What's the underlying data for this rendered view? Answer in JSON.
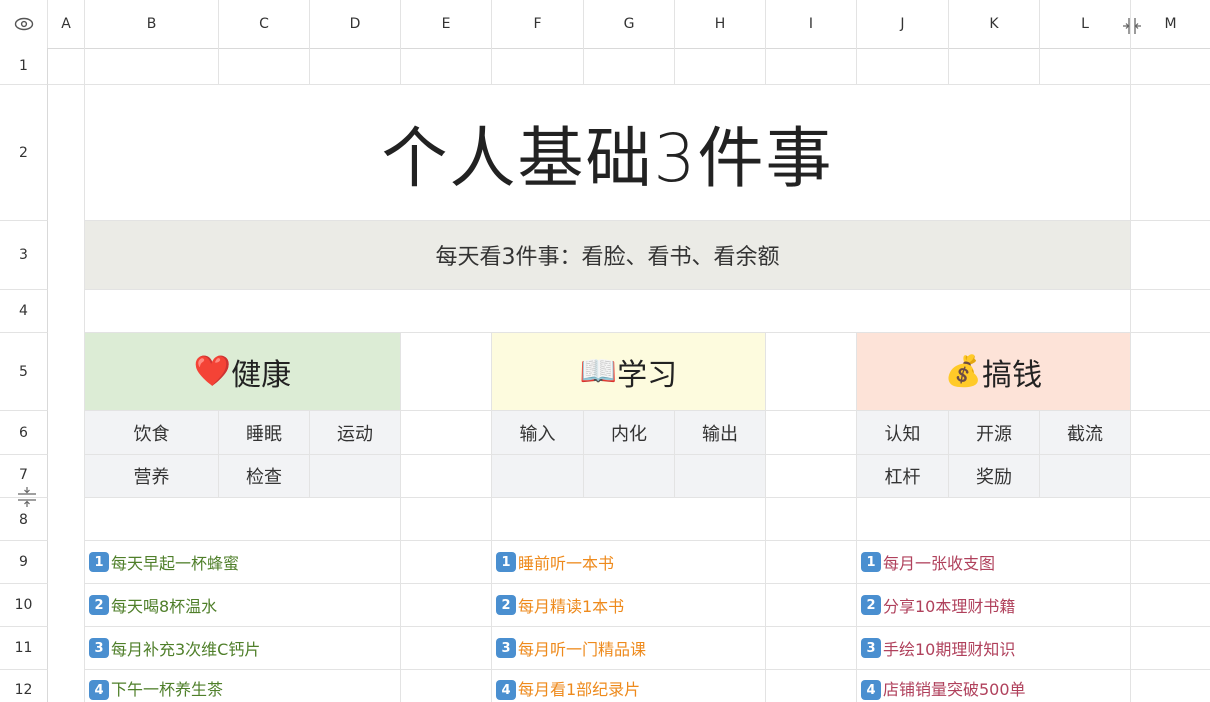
{
  "columns": [
    "A",
    "B",
    "C",
    "D",
    "E",
    "F",
    "G",
    "H",
    "I",
    "J",
    "K",
    "L",
    "M"
  ],
  "rows": [
    "1",
    "2",
    "3",
    "4",
    "5",
    "6",
    "7",
    "8",
    "9",
    "10",
    "11",
    "12"
  ],
  "title": "个人基础3件事",
  "subtitle": "每天看3件事：看脸、看书、看余额",
  "sections": [
    {
      "label": "健康",
      "icon": "❤️"
    },
    {
      "label": "学习",
      "icon": "📖"
    },
    {
      "label": "搞钱",
      "icon": "💰"
    }
  ],
  "health_sub": {
    "r6": [
      "饮食",
      "睡眠",
      "运动"
    ],
    "r7": [
      "营养",
      "检查"
    ]
  },
  "study_sub": {
    "r6": [
      "输入",
      "内化",
      "输出"
    ]
  },
  "money_sub": {
    "r6": [
      "认知",
      "开源",
      "截流"
    ],
    "r7": [
      "杠杆",
      "奖励"
    ]
  },
  "health_items": [
    {
      "num": "1",
      "text": "每天早起一杯蜂蜜"
    },
    {
      "num": "2",
      "text": "每天喝8杯温水"
    },
    {
      "num": "3",
      "text": "每月补充3次维C钙片"
    },
    {
      "num": "4",
      "text": "下午一杯养生茶"
    }
  ],
  "study_items": [
    {
      "num": "1",
      "text": "睡前听一本书"
    },
    {
      "num": "2",
      "text": "每月精读1本书"
    },
    {
      "num": "3",
      "text": "每月听一门精品课"
    },
    {
      "num": "4",
      "text": "每月看1部纪录片"
    }
  ],
  "money_items": [
    {
      "num": "1",
      "text": "每月一张收支图"
    },
    {
      "num": "2",
      "text": "分享10本理财书籍"
    },
    {
      "num": "3",
      "text": "手绘10期理财知识"
    },
    {
      "num": "4",
      "text": "店铺销量突破500单"
    }
  ],
  "colors": {
    "health_bg": "#dcecd5",
    "study_bg": "#fdfbde",
    "money_bg": "#fde3d8",
    "sub_bg": "#f2f3f5",
    "subtitle_bg": "#ebebe6",
    "health_text": "#4f7f2a",
    "study_text": "#ee8a1c",
    "money_text": "#b0415c"
  },
  "icons": {
    "eye": "eye-icon",
    "col_resize": "column-resize-icon",
    "row_resize": "row-resize-icon"
  }
}
